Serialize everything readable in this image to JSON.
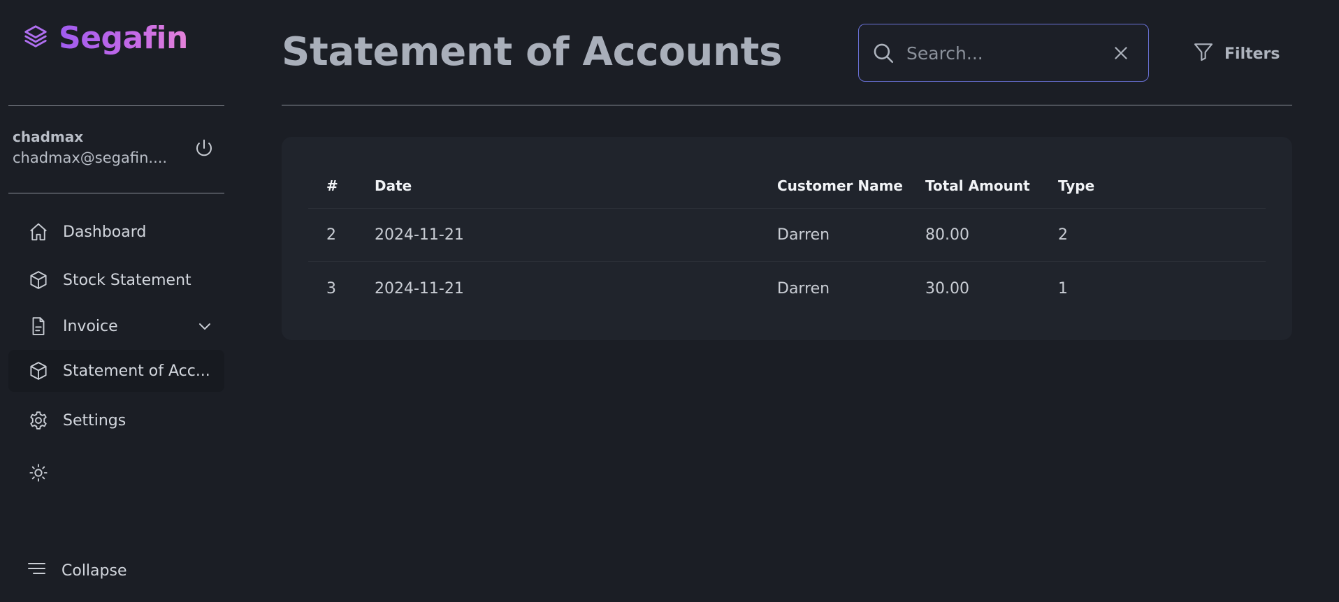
{
  "brand": {
    "name": "Segafin",
    "icon": "layers-icon"
  },
  "user": {
    "name": "chadmax",
    "email": "chadmax@segafin....",
    "logout_icon": "power-icon"
  },
  "nav": {
    "items": [
      {
        "label": "Dashboard",
        "icon": "home-icon"
      },
      {
        "label": "Stock Statement",
        "icon": "box-icon"
      },
      {
        "label": "Invoice",
        "icon": "file-icon",
        "has_submenu": true
      },
      {
        "label": "Statement of Acc...",
        "icon": "box-icon",
        "active": true
      },
      {
        "label": "Settings",
        "icon": "gear-icon"
      }
    ],
    "theme_icon": "sun-icon",
    "collapse_label": "Collapse"
  },
  "page": {
    "title": "Statement of Accounts"
  },
  "search": {
    "placeholder": "Search...",
    "value": ""
  },
  "filters": {
    "label": "Filters"
  },
  "table": {
    "columns": [
      "#",
      "Date",
      "Customer Name",
      "Total Amount",
      "Type"
    ],
    "rows": [
      [
        "2",
        "2024-11-21",
        "Darren",
        "80.00",
        "2"
      ],
      [
        "3",
        "2024-11-21",
        "Darren",
        "30.00",
        "1"
      ]
    ]
  },
  "colors": {
    "background": "#1b1e25",
    "card": "#20242c",
    "accent_border": "#6a72d8",
    "brand_gradient_start": "#a05cf0",
    "brand_gradient_end": "#e583d9"
  }
}
